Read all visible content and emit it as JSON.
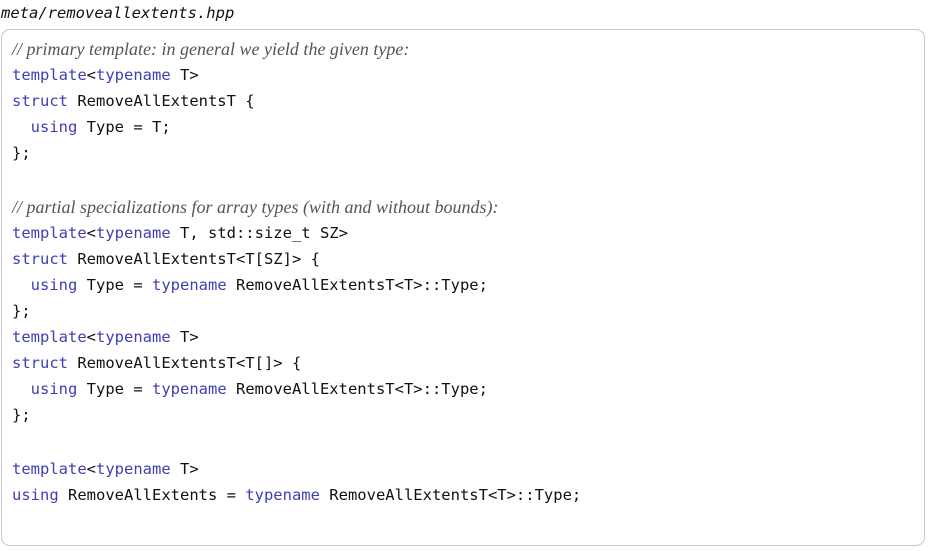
{
  "filename": "meta/removeallextents.hpp",
  "lines": [
    {
      "comment": "// primary template: in general we yield the given type:"
    },
    {
      "tokens": [
        {
          "text": "template",
          "kw": true
        },
        {
          "text": "<"
        },
        {
          "text": "typename",
          "kw": true
        },
        {
          "text": " T>"
        }
      ]
    },
    {
      "tokens": [
        {
          "text": "struct",
          "kw": true
        },
        {
          "text": " RemoveAllExtentsT {"
        }
      ]
    },
    {
      "tokens": [
        {
          "text": "  "
        },
        {
          "text": "using",
          "kw": true
        },
        {
          "text": " Type = T;"
        }
      ]
    },
    {
      "tokens": [
        {
          "text": "};"
        }
      ]
    },
    {
      "blank": true
    },
    {
      "comment": "// partial specializations for array types (with and without bounds):"
    },
    {
      "tokens": [
        {
          "text": "template",
          "kw": true
        },
        {
          "text": "<"
        },
        {
          "text": "typename",
          "kw": true
        },
        {
          "text": " T, std::size_t SZ>"
        }
      ]
    },
    {
      "tokens": [
        {
          "text": "struct",
          "kw": true
        },
        {
          "text": " RemoveAllExtentsT<T[SZ]> {"
        }
      ]
    },
    {
      "tokens": [
        {
          "text": "  "
        },
        {
          "text": "using",
          "kw": true
        },
        {
          "text": " Type = "
        },
        {
          "text": "typename",
          "kw": true
        },
        {
          "text": " RemoveAllExtentsT<T>::Type;"
        }
      ]
    },
    {
      "tokens": [
        {
          "text": "};"
        }
      ]
    },
    {
      "tokens": [
        {
          "text": "template",
          "kw": true
        },
        {
          "text": "<"
        },
        {
          "text": "typename",
          "kw": true
        },
        {
          "text": " T>"
        }
      ]
    },
    {
      "tokens": [
        {
          "text": "struct",
          "kw": true
        },
        {
          "text": " RemoveAllExtentsT<T[]> {"
        }
      ]
    },
    {
      "tokens": [
        {
          "text": "  "
        },
        {
          "text": "using",
          "kw": true
        },
        {
          "text": " Type = "
        },
        {
          "text": "typename",
          "kw": true
        },
        {
          "text": " RemoveAllExtentsT<T>::Type;"
        }
      ]
    },
    {
      "tokens": [
        {
          "text": "};"
        }
      ]
    },
    {
      "blank": true
    },
    {
      "tokens": [
        {
          "text": "template",
          "kw": true
        },
        {
          "text": "<"
        },
        {
          "text": "typename",
          "kw": true
        },
        {
          "text": " T>"
        }
      ]
    },
    {
      "tokens": [
        {
          "text": "using",
          "kw": true
        },
        {
          "text": " RemoveAllExtents = "
        },
        {
          "text": "typename",
          "kw": true
        },
        {
          "text": " RemoveAllExtentsT<T>::Type;"
        }
      ]
    }
  ]
}
